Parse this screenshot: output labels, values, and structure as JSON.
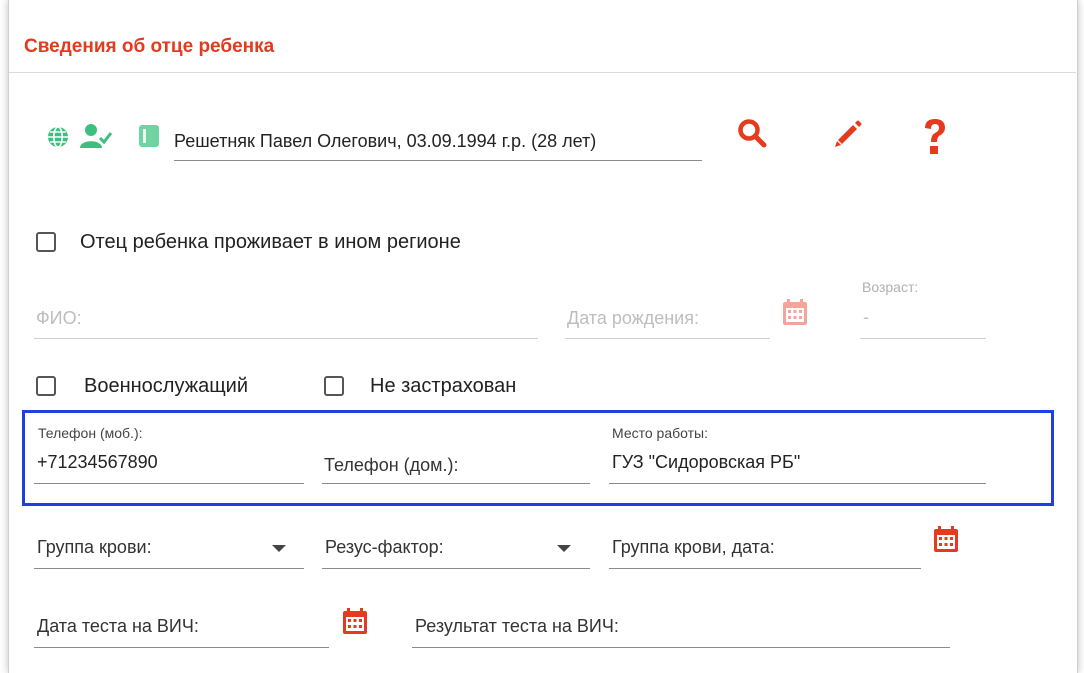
{
  "section": {
    "title": "Сведения об отце ребенка"
  },
  "father": {
    "selected": "Решетняк Павел Олегович, 03.09.1994 г.р. (28 лет)"
  },
  "icons": {
    "globe": "globe-icon",
    "user_check": "user-check-icon",
    "card": "card-icon",
    "search": "search-icon",
    "edit": "pencil-icon",
    "help": "question-icon",
    "calendar": "calendar-icon",
    "dropdown": "chevron-down-icon"
  },
  "other_region": {
    "label": "Отец ребенка проживает в ином регионе",
    "checked": false
  },
  "fio": {
    "placeholder": "ФИО:"
  },
  "birth_date": {
    "placeholder": "Дата рождения:"
  },
  "age": {
    "label": "Возраст:",
    "value": "-"
  },
  "military": {
    "label": "Военнослужащий",
    "checked": false
  },
  "uninsured": {
    "label": "Не застрахован",
    "checked": false
  },
  "phone_mobile": {
    "label": "Телефон (моб.):",
    "value": "+71234567890"
  },
  "phone_home": {
    "placeholder": "Телефон (дом.):"
  },
  "workplace": {
    "label": "Место работы:",
    "value": "ГУЗ \"Сидоровская РБ\""
  },
  "blood_group": {
    "placeholder": "Группа крови:"
  },
  "rhesus": {
    "placeholder": "Резус-фактор:"
  },
  "blood_group_date": {
    "placeholder": "Группа крови, дата:"
  },
  "hiv_test_date": {
    "placeholder": "Дата теста на ВИЧ:"
  },
  "hiv_test_result": {
    "placeholder": "Результат теста на ВИЧ:"
  },
  "colors": {
    "accent": "#e53a1e",
    "green": "#3dbf7f",
    "highlight": "#1f3fe0"
  }
}
